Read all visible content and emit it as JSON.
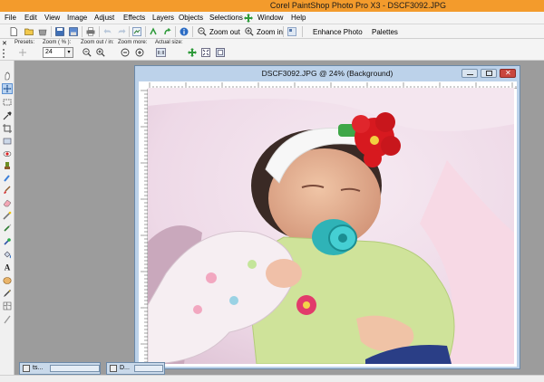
{
  "window": {
    "title": "Corel PaintShop Photo Pro X3 - DSCF3092.JPG"
  },
  "menu": {
    "file": "File",
    "edit": "Edit",
    "view": "View",
    "image": "Image",
    "adjust": "Adjust",
    "effects": "Effects",
    "layers": "Layers",
    "objects": "Objects",
    "selections": "Selections",
    "window": "Window",
    "help": "Help"
  },
  "toolbar": {
    "zoom_out": "Zoom out",
    "zoom_in": "Zoom in",
    "enhance_photo": "Enhance Photo",
    "palettes": "Palettes"
  },
  "tool_options": {
    "presets_label": "Presets:",
    "zoom_pct_label": "Zoom ( % ):",
    "zoom_value": "24",
    "zoom_out_in_label": "Zoom out / in:",
    "zoom_more_label": "Zoom more:",
    "actual_size_label": "Actual size:"
  },
  "document": {
    "title": "DSCF3092.JPG @  24% (Background)"
  },
  "minimized": {
    "tab1": "ts...",
    "tab2": "D..."
  },
  "colors": {
    "titlebar": "#f39b2c",
    "doc_frame": "#bcd2ea",
    "workspace": "#9c9c9c"
  }
}
